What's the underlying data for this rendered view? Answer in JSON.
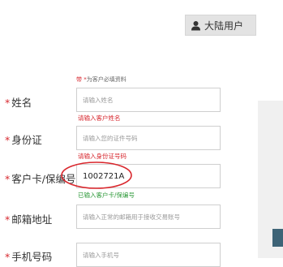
{
  "header": {
    "login_tab_label": "大陆用户",
    "login_tab_icon": "user-icon"
  },
  "form": {
    "required_note_star": "带 *",
    "required_note_text": "为客户必填资料",
    "rows": [
      {
        "label": "姓名",
        "placeholder": "请输入姓名",
        "value": "",
        "message": "请输入客户姓名",
        "message_type": "error"
      },
      {
        "label": "身份证",
        "placeholder": "请输入您的证件号码",
        "value": "",
        "message": "请输入身份证号码",
        "message_type": "error"
      },
      {
        "label": "客户卡/保编号",
        "placeholder": "",
        "value": "1002721A",
        "message": "已输入客户卡/保编号",
        "message_type": "ok"
      },
      {
        "label": "邮箱地址",
        "placeholder": "请输入正常的邮箱用于接收交易账号",
        "value": "",
        "message": "",
        "message_type": ""
      },
      {
        "label": "手机号码",
        "placeholder": "请输入手机号",
        "value": "",
        "message": "",
        "message_type": ""
      }
    ]
  },
  "colors": {
    "required_red": "#d7282f",
    "ok_green": "#2f9a3b",
    "annotation_circle": "#d9262c",
    "side_button": "#3e6477"
  }
}
